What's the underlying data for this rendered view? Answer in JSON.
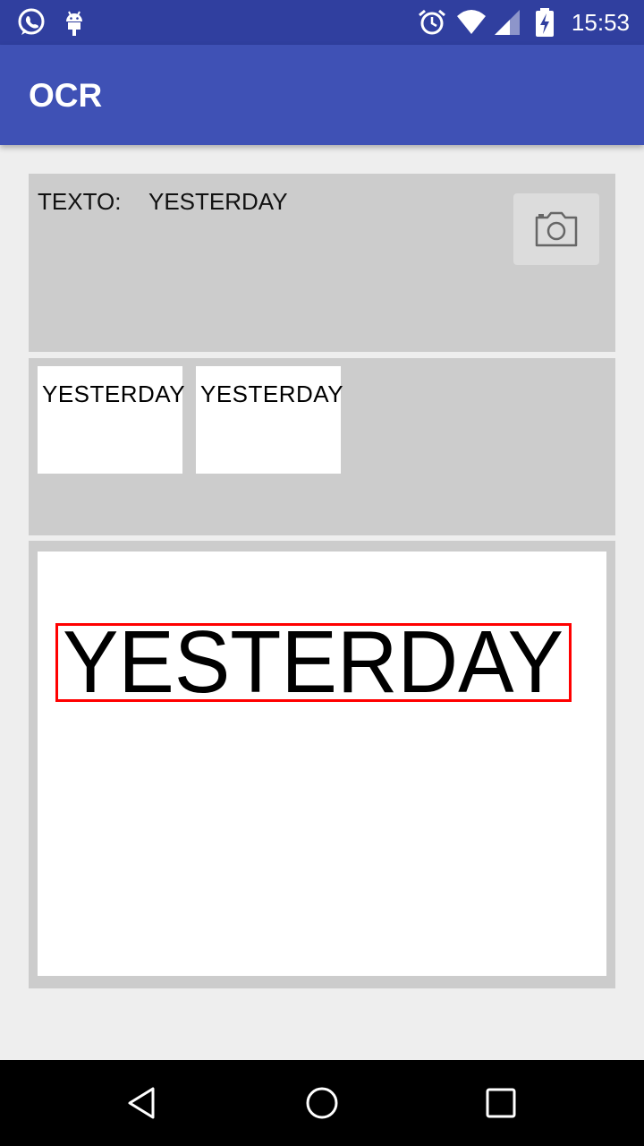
{
  "status_bar": {
    "time": "15:53",
    "icons": [
      "whatsapp-icon",
      "android-debug-icon",
      "alarm-icon",
      "wifi-icon",
      "signal-icon",
      "battery-charging-icon"
    ]
  },
  "app_bar": {
    "title": "OCR"
  },
  "result": {
    "label": "TEXTO:",
    "value": "YESTERDAY"
  },
  "camera_button": {
    "icon": "camera-icon"
  },
  "thumbnails": [
    {
      "text": "YESTERDAY"
    },
    {
      "text": "YESTERDAY"
    }
  ],
  "preview": {
    "detected_text": "YESTERDAY",
    "box_color": "#ff0000"
  },
  "nav_bar": {
    "icons": [
      "back-icon",
      "home-icon",
      "recents-icon"
    ]
  },
  "colors": {
    "status_bar": "#303f9f",
    "app_bar": "#3f51b5",
    "panel": "#cccccc",
    "background": "#eeeeee"
  }
}
